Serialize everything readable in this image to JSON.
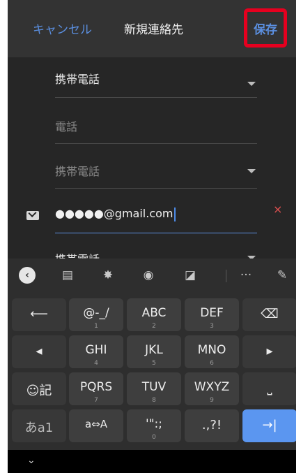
{
  "header": {
    "cancel": "キャンセル",
    "title": "新規連絡先",
    "save": "保存"
  },
  "form": {
    "phone_type_1": "携帯電話",
    "phone_placeholder": "電話",
    "phone_type_2": "携帯電話",
    "email_value": "●●●●●@gmail.com",
    "phone_type_3": "携帯電話",
    "clear_icon": "×"
  },
  "keyboard": {
    "toolbar": {
      "back": "‹",
      "clipboard": "▤",
      "settings": "✸",
      "theme": "◉",
      "resize": "◪",
      "more": "···",
      "mic_off": "✎"
    },
    "keys": {
      "undo": "⟵",
      "at": "@-_/",
      "at_sub": "1",
      "abc": "ABC",
      "abc_sub": "2",
      "def": "DEF",
      "def_sub": "3",
      "backspace": "⌫",
      "left": "◂",
      "ghi": "GHI",
      "ghi_sub": "4",
      "jkl": "JKL",
      "jkl_sub": "5",
      "mno": "MNO",
      "mno_sub": "6",
      "right": "▸",
      "emoji": "☺記",
      "pqrs": "PQRS",
      "pqrs_sub": "7",
      "tuv": "TUV",
      "tuv_sub": "8",
      "wxyz": "WXYZ",
      "wxyz_sub": "9",
      "space": "⎵",
      "mode": "あa1",
      "case": "a⇔A",
      "quotes": "'\":;",
      "quotes_sub": "0",
      "punct": ".,?!",
      "enter": "→|"
    }
  },
  "navbar": {
    "chevron": "⌄"
  },
  "colors": {
    "accent": "#5b8fe0",
    "highlight_box": "#e6001f",
    "enter_key": "#5b96f0"
  }
}
